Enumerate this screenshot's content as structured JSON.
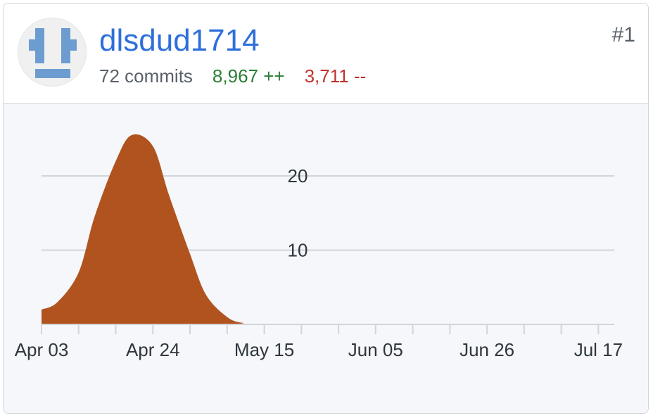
{
  "user": {
    "username": "dlsdud1714",
    "rank": "#1",
    "commits": "72 commits",
    "additions": "8,967 ++",
    "deletions": "3,711 --"
  },
  "colors": {
    "username": "#2f6fdb",
    "additions": "#2a7d35",
    "deletions": "#c2322b",
    "area_fill": "#b0531e",
    "avatar_blue": "#6d9dd0"
  },
  "chart_data": {
    "type": "area",
    "x_tick_labels": [
      "Apr 03",
      "Apr 24",
      "May 15",
      "Jun 05",
      "Jun 26",
      "Jul 17"
    ],
    "y_tick_labels": [
      "10",
      "20"
    ],
    "ylim": [
      0,
      27
    ],
    "grid": true,
    "x": [
      "Apr 03",
      "Apr 06",
      "Apr 10",
      "Apr 13",
      "Apr 17",
      "Apr 20",
      "Apr 24",
      "Apr 27",
      "May 01",
      "May 04",
      "May 08",
      "May 11",
      "May 15",
      "Jul 20"
    ],
    "series": [
      {
        "values": [
          2,
          3,
          7,
          14.5,
          22,
          25.5,
          24,
          17.5,
          9.5,
          4,
          1,
          0.2,
          0,
          0
        ]
      }
    ]
  }
}
